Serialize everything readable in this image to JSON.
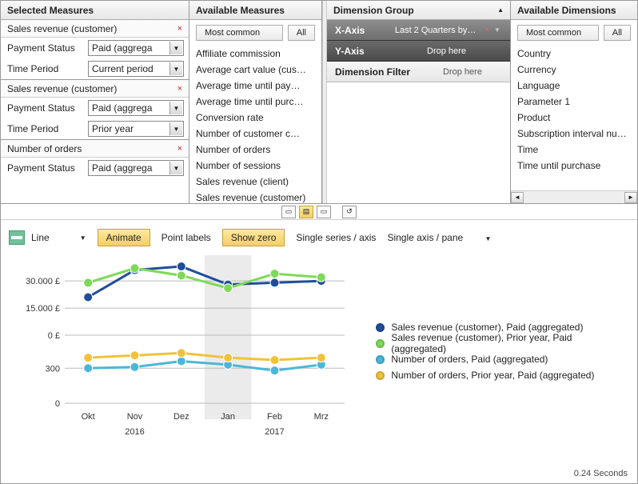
{
  "selected_measures": {
    "header": "Selected Measures",
    "groups": [
      {
        "title": "Sales revenue (customer)",
        "rows": [
          {
            "label": "Payment Status",
            "value": "Paid (aggrega"
          },
          {
            "label": "Time Period",
            "value": "Current period"
          }
        ]
      },
      {
        "title": "Sales revenue (customer)",
        "rows": [
          {
            "label": "Payment Status",
            "value": "Paid (aggrega"
          },
          {
            "label": "Time Period",
            "value": "Prior year"
          }
        ]
      },
      {
        "title": "Number of orders",
        "rows": [
          {
            "label": "Payment Status",
            "value": "Paid (aggrega"
          }
        ]
      }
    ]
  },
  "available_measures": {
    "header": "Available Measures",
    "filter_selected": "Most common",
    "filter_all": "All",
    "items": [
      "Affiliate commission",
      "Average cart value (cus…",
      "Average time until pay…",
      "Average time until purc…",
      "Conversion rate",
      "Number of customer c…",
      "Number of orders",
      "Number of sessions",
      "Sales revenue (client)",
      "Sales revenue (customer)"
    ]
  },
  "dimension_group": {
    "header": "Dimension Group",
    "xaxis": {
      "name": "X-Axis",
      "value": "Last 2 Quarters by…"
    },
    "yaxis": {
      "name": "Y-Axis",
      "value": "Drop here"
    },
    "filter": {
      "name": "Dimension Filter",
      "value": "Drop here"
    }
  },
  "available_dimensions": {
    "header": "Available Dimensions",
    "filter_selected": "Most common",
    "filter_all": "All",
    "items": [
      "Country",
      "Currency",
      "Language",
      "Parameter 1",
      "Product",
      "Subscription interval numbe",
      "Time",
      "Time until purchase"
    ]
  },
  "chart_toolbar": {
    "type_label": "Line",
    "animate": "Animate",
    "point_labels": "Point labels",
    "show_zero": "Show zero",
    "series_mode": "Single series / axis",
    "pane_mode": "Single axis / pane"
  },
  "legend": [
    {
      "label": "Sales revenue (customer), Paid (aggregated)",
      "color": "#1f4e9b"
    },
    {
      "label": "Sales revenue (customer), Prior year, Paid (aggregated)",
      "color": "#7ed957"
    },
    {
      "label": "Number of orders, Paid (aggregated)",
      "color": "#4bb7d8"
    },
    {
      "label": "Number of orders, Prior year, Paid (aggregated)",
      "color": "#f0c23c"
    }
  ],
  "chart_data": [
    {
      "type": "line",
      "title": "",
      "xlabel": "",
      "ylabel": "",
      "categories": [
        "Okt",
        "Nov",
        "Dez",
        "Jan",
        "Feb",
        "Mrz"
      ],
      "year_groups": [
        {
          "label": "2016",
          "span": [
            "Okt",
            "Nov",
            "Dez"
          ]
        },
        {
          "label": "2017",
          "span": [
            "Jan",
            "Feb",
            "Mrz"
          ]
        }
      ],
      "yticks": [
        "0 £",
        "15.000 £",
        "30.000 £"
      ],
      "ylim": [
        0,
        42000
      ],
      "series": [
        {
          "name": "Sales revenue (customer), Paid (aggregated)",
          "color": "#1f4e9b",
          "values": [
            21000,
            36000,
            38000,
            28000,
            29000,
            30000
          ]
        },
        {
          "name": "Sales revenue (customer), Prior year, Paid (aggregated)",
          "color": "#7ed957",
          "values": [
            29000,
            37000,
            33000,
            26000,
            34000,
            32000
          ]
        }
      ]
    },
    {
      "type": "line",
      "title": "",
      "xlabel": "",
      "ylabel": "",
      "categories": [
        "Okt",
        "Nov",
        "Dez",
        "Jan",
        "Feb",
        "Mrz"
      ],
      "yticks": [
        "0",
        "300"
      ],
      "ylim": [
        0,
        480
      ],
      "series": [
        {
          "name": "Number of orders, Paid (aggregated)",
          "color": "#4bb7d8",
          "values": [
            300,
            310,
            360,
            330,
            280,
            330
          ]
        },
        {
          "name": "Number of orders, Prior year, Paid (aggregated)",
          "color": "#f0c23c",
          "values": [
            390,
            410,
            430,
            390,
            370,
            390
          ]
        }
      ]
    }
  ],
  "footer_time": "0.24 Seconds"
}
